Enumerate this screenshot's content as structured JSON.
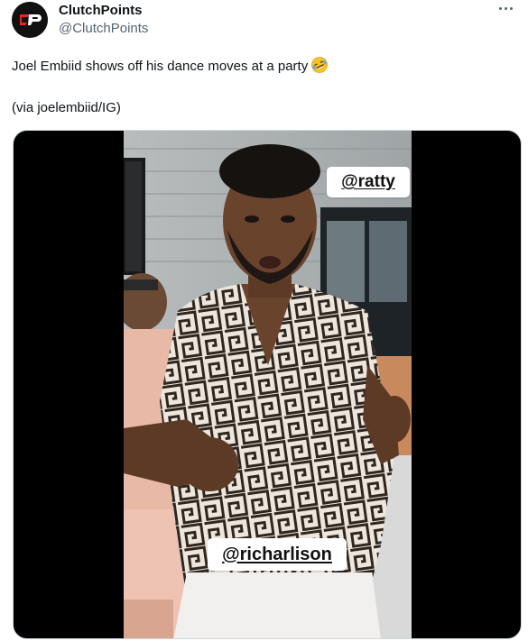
{
  "author": {
    "display_name": "ClutchPoints",
    "handle": "@ClutchPoints",
    "avatar_initials": "CP",
    "avatar_colors": {
      "background": "#111111",
      "accent": "#e8262a"
    }
  },
  "more_button": {
    "icon": "more-horizontal-icon"
  },
  "tweet": {
    "text": "Joel Embiid shows off his dance moves at a party",
    "emoji": "rolling-on-floor-laughing-emoji",
    "credit": "(via joelembiid/IG)"
  },
  "media": {
    "type": "video",
    "stickers": {
      "top": "@ratty",
      "bottom": "@richarlison"
    }
  },
  "colors": {
    "text_primary": "#0f1419",
    "text_secondary": "#536471",
    "media_border": "#cfd9de"
  }
}
